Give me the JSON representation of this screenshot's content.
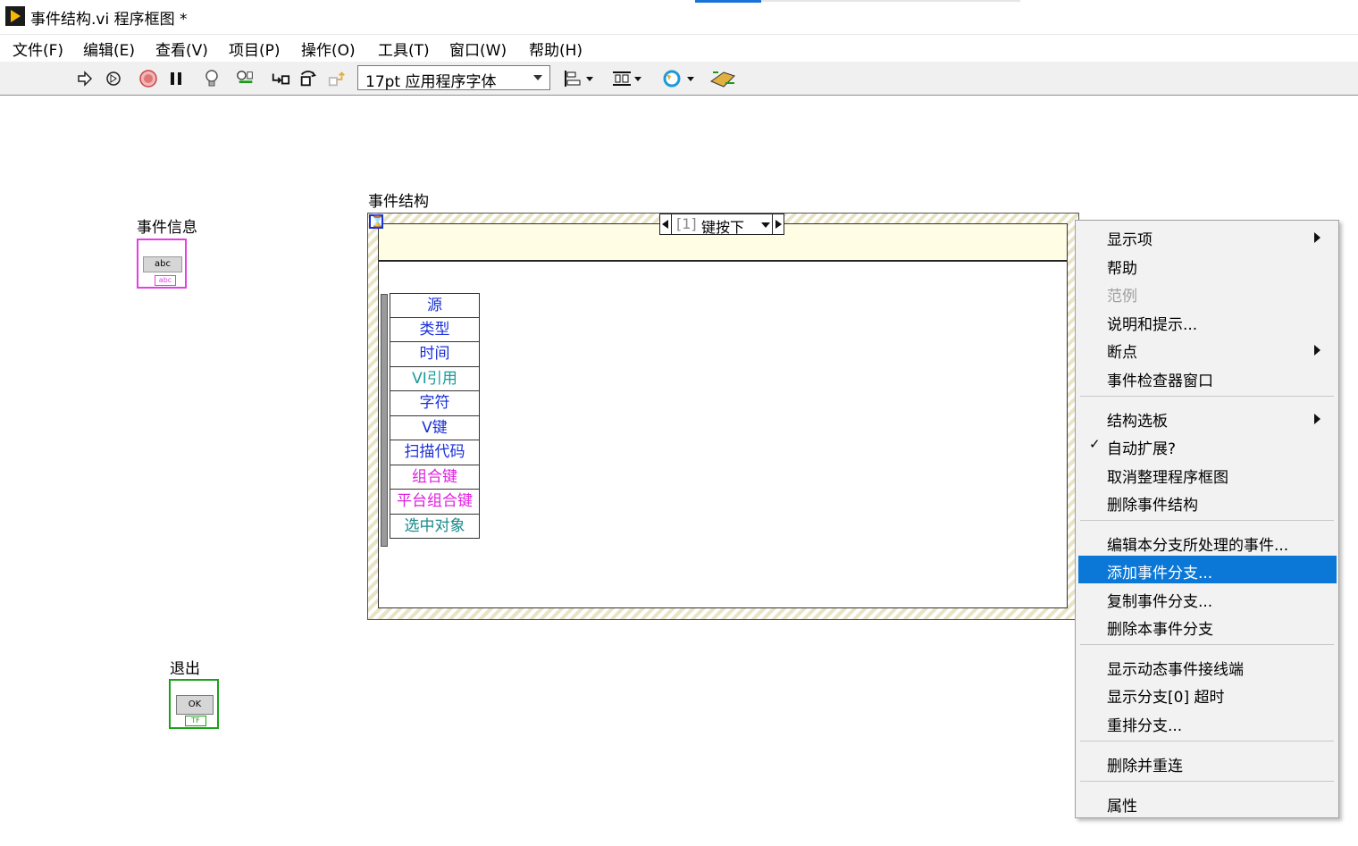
{
  "window": {
    "title": "事件结构.vi 程序框图 *"
  },
  "menubar": [
    "文件(F)",
    "编辑(E)",
    "查看(V)",
    "项目(P)",
    "操作(O)",
    "工具(T)",
    "窗口(W)",
    "帮助(H)"
  ],
  "toolbar": {
    "font_select": "17pt 应用程序字体",
    "icons": [
      "run-arrow-icon",
      "run-continuously-icon",
      "abort-icon",
      "pause-icon",
      "highlight-execution-icon",
      "retain-wire-values-icon",
      "step-into-icon",
      "step-over-icon",
      "step-out-icon",
      "align-objects-icon",
      "distribute-objects-icon",
      "reorder-icon",
      "cleanup-diagram-icon"
    ]
  },
  "canvas": {
    "string_label": "事件信息",
    "string_inner": "abc",
    "string_tag": "abc",
    "bool_label": "退出",
    "bool_inner": "OK",
    "bool_tag": "TF",
    "event_structure_label": "事件结构",
    "selector_index": "[1]",
    "selector_name": "键按下",
    "event_data": [
      {
        "text": "源",
        "color": "#1a30d9"
      },
      {
        "text": "类型",
        "color": "#1a30d9"
      },
      {
        "text": "时间",
        "color": "#1a30d9"
      },
      {
        "text": "VI引用",
        "color": "#1a9a9a"
      },
      {
        "text": "字符",
        "color": "#1a30d9"
      },
      {
        "text": "V键",
        "color": "#1a30d9"
      },
      {
        "text": "扫描代码",
        "color": "#1a30d9"
      },
      {
        "text": "组合键",
        "color": "#e020e0"
      },
      {
        "text": "平台组合键",
        "color": "#e020e0"
      },
      {
        "text": "选中对象",
        "color": "#1a8a8a"
      }
    ]
  },
  "context_menu": {
    "items": [
      {
        "label": "显示项",
        "submenu": true
      },
      {
        "label": "帮助"
      },
      {
        "label": "范例",
        "disabled": true
      },
      {
        "label": "说明和提示..."
      },
      {
        "label": "断点",
        "submenu": true
      },
      {
        "label": "事件检查器窗口"
      },
      {
        "label": "结构选板",
        "submenu": true
      },
      {
        "label": "自动扩展?",
        "checked": true
      },
      {
        "label": "取消整理程序框图"
      },
      {
        "label": "删除事件结构"
      },
      {
        "label": "编辑本分支所处理的事件..."
      },
      {
        "label": "添加事件分支...",
        "active": true
      },
      {
        "label": "复制事件分支..."
      },
      {
        "label": "删除本事件分支"
      },
      {
        "label": "显示动态事件接线端"
      },
      {
        "label": "显示分支[0] 超时"
      },
      {
        "label": "重排分支..."
      },
      {
        "label": "删除并重连"
      },
      {
        "label": "属性"
      }
    ],
    "check_mark": "✓"
  },
  "colors": {
    "accent": "#0b78d7",
    "string_wire": "#e43ee4",
    "bool_wire": "#1aa11a"
  }
}
